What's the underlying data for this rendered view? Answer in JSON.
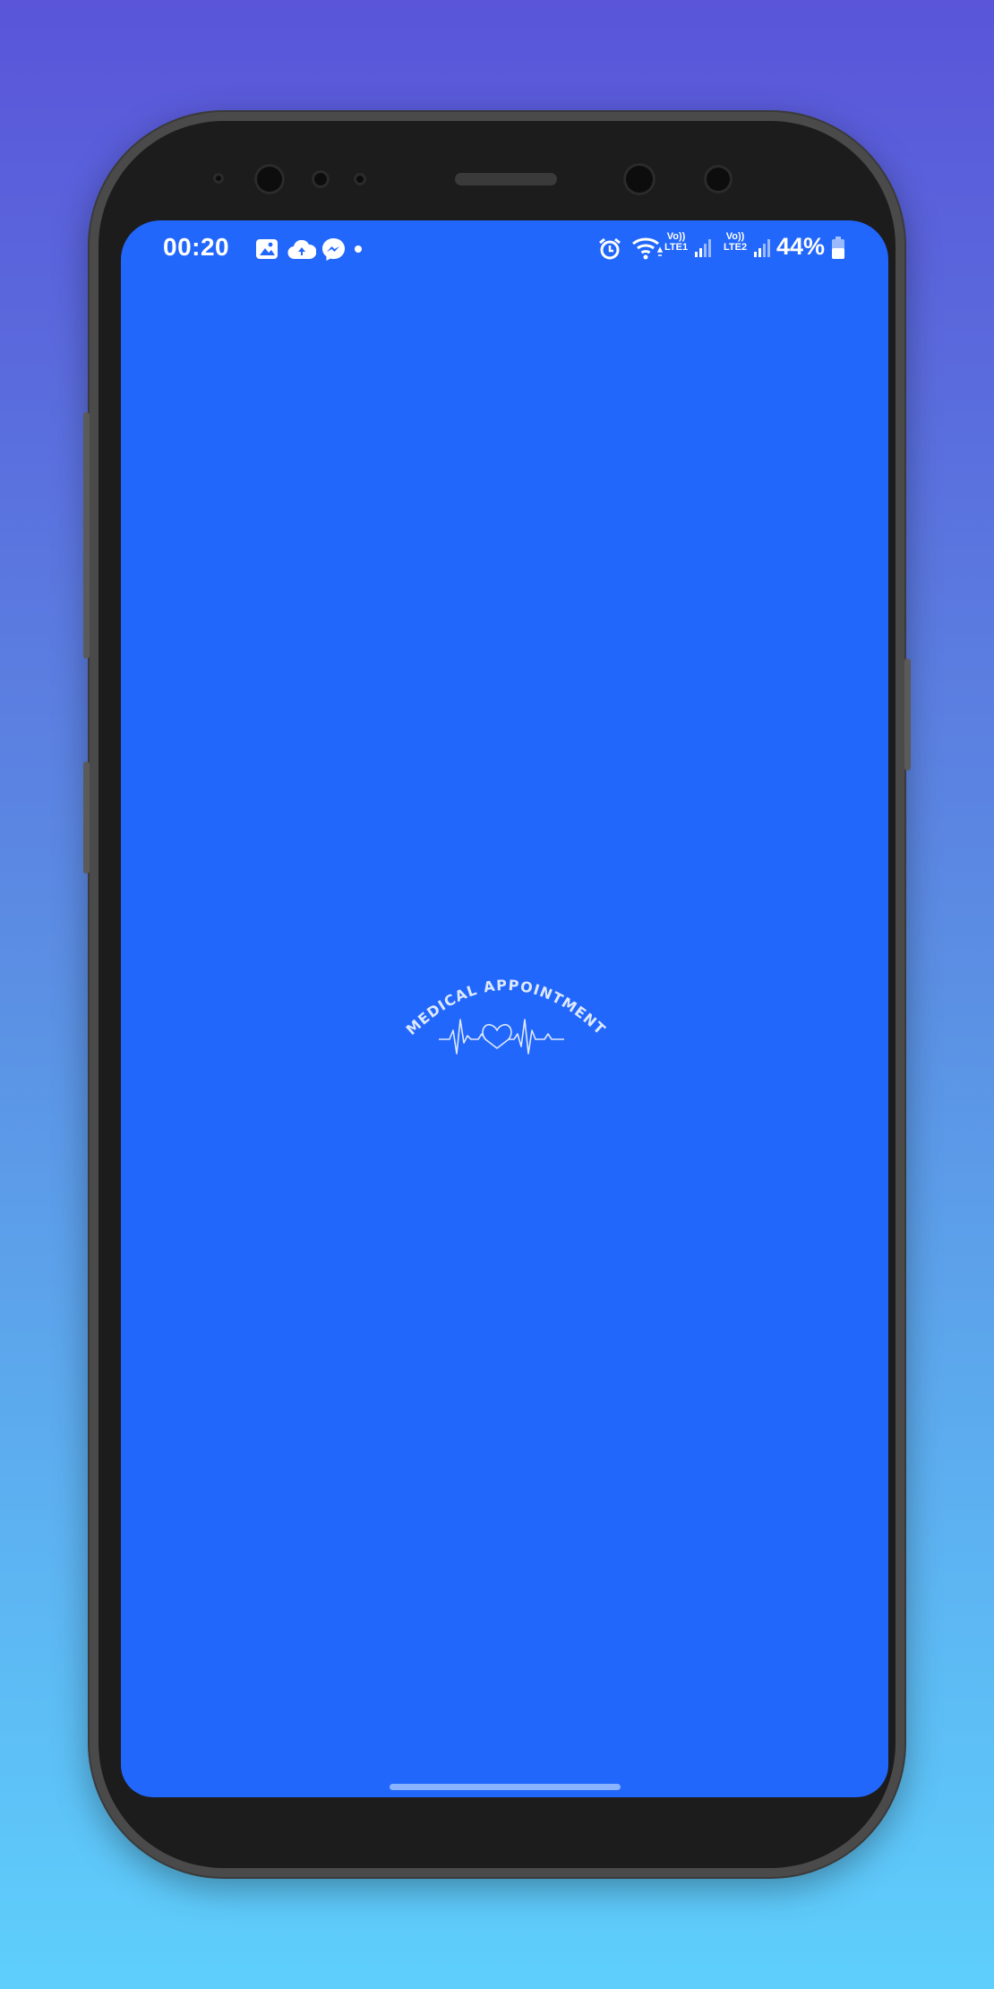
{
  "status_bar": {
    "time": "00:20",
    "battery": "44%",
    "sim1_volte": "Vo))",
    "sim1_network": "LTE1",
    "sim2_volte": "Vo))",
    "sim2_network": "LTE2",
    "icons": [
      "gallery-icon",
      "cloud-upload-icon",
      "messenger-icon",
      "dot-icon",
      "alarm-icon",
      "wifi-icon",
      "signal-icon",
      "signal-icon",
      "battery-icon"
    ]
  },
  "splash": {
    "logo_text": "MEDICAL APPOINTMENT",
    "logo_icon": "heartbeat-heart-icon",
    "background_color": "#2267fb"
  }
}
